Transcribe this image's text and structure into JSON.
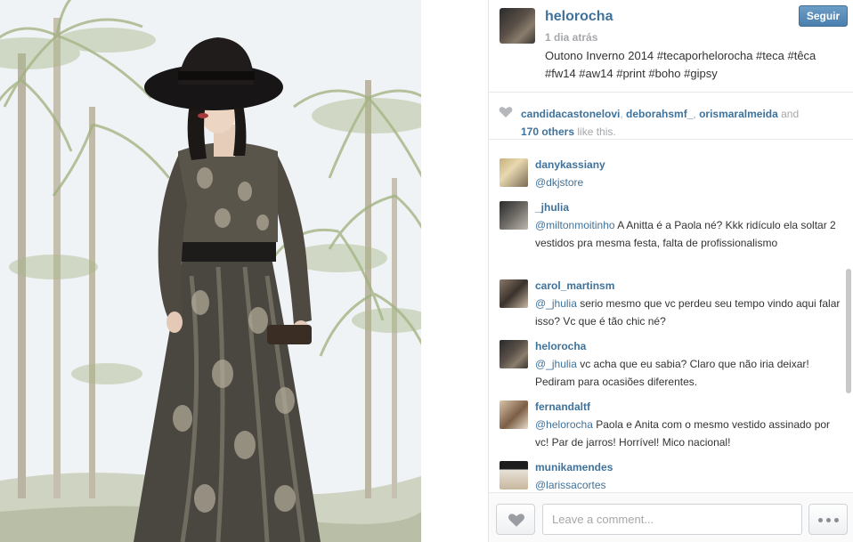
{
  "post": {
    "username": "helorocha",
    "follow_label": "Seguir",
    "time": "1 dia atrás",
    "caption": "Outono Inverno 2014 #tecaporhelorocha #teca #têca #fw14 #aw14 #print #boho #gipsy"
  },
  "likes": {
    "users": [
      "candidacastonelovi",
      "deborahsmf_",
      "orismaralmeida"
    ],
    "sep1": ", ",
    "sep2": ", ",
    "and": " and",
    "others_count": "170 others",
    "suffix": " like this."
  },
  "comments": [
    {
      "username": "danykassiany",
      "mention": "@dkjstore",
      "text": ""
    },
    {
      "username": "_jhulia",
      "mention": "@miltonmoitinho",
      "text": " A Anitta é a Paola né? Kkk ridículo ela soltar 2 vestidos pra mesma festa, falta de profissionalismo"
    },
    {
      "username": "carol_martinsm",
      "mention": "@_jhulia",
      "text": " serio mesmo que vc perdeu seu tempo vindo aqui falar isso? Vc que é tão chic né?"
    },
    {
      "username": "helorocha",
      "mention": "@_jhulia",
      "text": " vc acha que eu sabia? Claro que não iria deixar! Pediram para ocasiões diferentes."
    },
    {
      "username": "fernandaltf",
      "mention": "@helorocha",
      "text": " Paola e Anita com o mesmo vestido assinado por vc! Par de jarros! Horrível! Mico nacional!"
    },
    {
      "username": "munikamendes",
      "mention": "@larissacortes",
      "text": ""
    }
  ],
  "footer": {
    "comment_placeholder": "Leave a comment..."
  },
  "icons": {
    "heart": "heart-icon",
    "more": "ellipsis-icon"
  },
  "colors": {
    "link": "#3f729b",
    "muted": "#a5a7aa",
    "follow_button": "#4a7fae"
  }
}
